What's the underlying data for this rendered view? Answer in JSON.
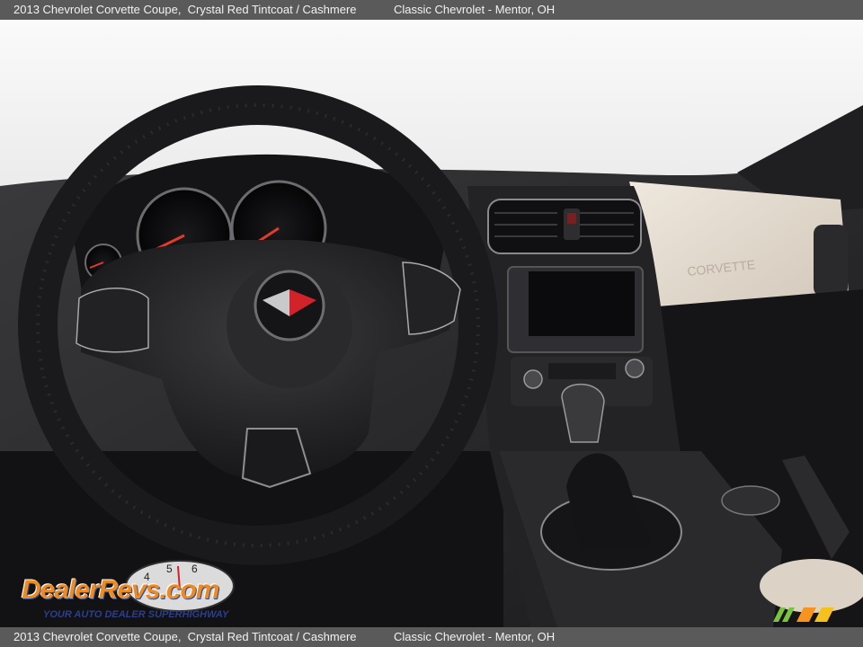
{
  "header": {
    "car": "2013 Chevrolet Corvette Coupe,  Crystal Red Tintcoat / Cashmere",
    "dealer": "Classic Chevrolet - Mentor, OH"
  },
  "footer": {
    "car": "2013 Chevrolet Corvette Coupe,  Crystal Red Tintcoat / Cashmere",
    "dealer": "Classic Chevrolet - Mentor, OH"
  },
  "watermark": {
    "brand": "DealerRevs.com",
    "tagline": "YOUR AUTO DEALER SUPERHIGHWAY",
    "secondary_logo": "mm"
  },
  "photo": {
    "subject": "steering-wheel-dashboard-interior",
    "colors": {
      "interior_dark": "#1c1c1e",
      "dash_trim": "#d9d0c4",
      "window_light": "#f4f4f2"
    }
  }
}
